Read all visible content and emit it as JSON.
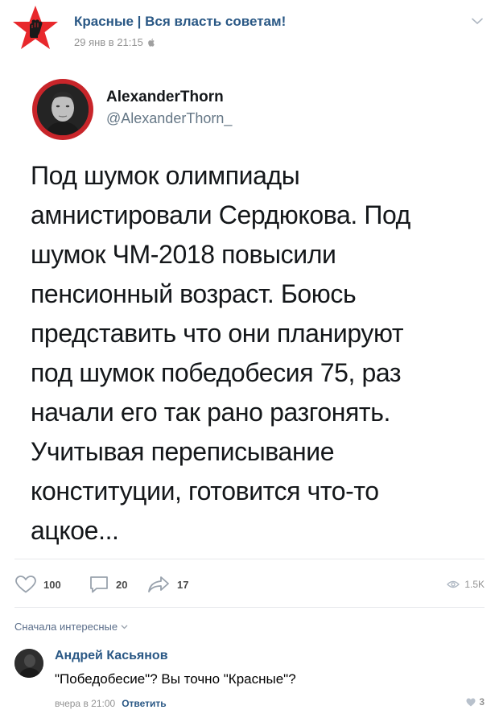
{
  "post": {
    "community_name": "Красные | Вся власть советам!",
    "timestamp": "29 янв в 21:15",
    "platform_icon": "apple-icon",
    "options_icon": "chevron-down-icon"
  },
  "tweet": {
    "author_name": "AlexanderThorn",
    "handle": "@AlexanderThorn_",
    "lines": [
      "Под шумок олимпиады",
      "амнистировали Сердюкова. Под",
      "шумок ЧМ-2018 повысили",
      "пенсионный возраст. Боюсь",
      "представить что они планируют",
      "под шумок победобесия 75, раз",
      "начали его так рано разгонять.",
      "Учитывая переписывание",
      "конституции, готовится что-то",
      "ацкое..."
    ]
  },
  "actions": {
    "likes": "100",
    "comments": "20",
    "shares": "17",
    "views": "1.5K"
  },
  "comments_section": {
    "sort_label": "Сначала интересные",
    "items": [
      {
        "author": "Андрей Касьянов",
        "text": "\"Победобесие\"? Вы точно \"Красные\"?",
        "time": "вчера в 21:00",
        "reply_label": "Ответить",
        "likes": "3"
      }
    ]
  },
  "colors": {
    "link": "#2a5885",
    "meta": "#939393",
    "brand_red": "#e8282c"
  }
}
